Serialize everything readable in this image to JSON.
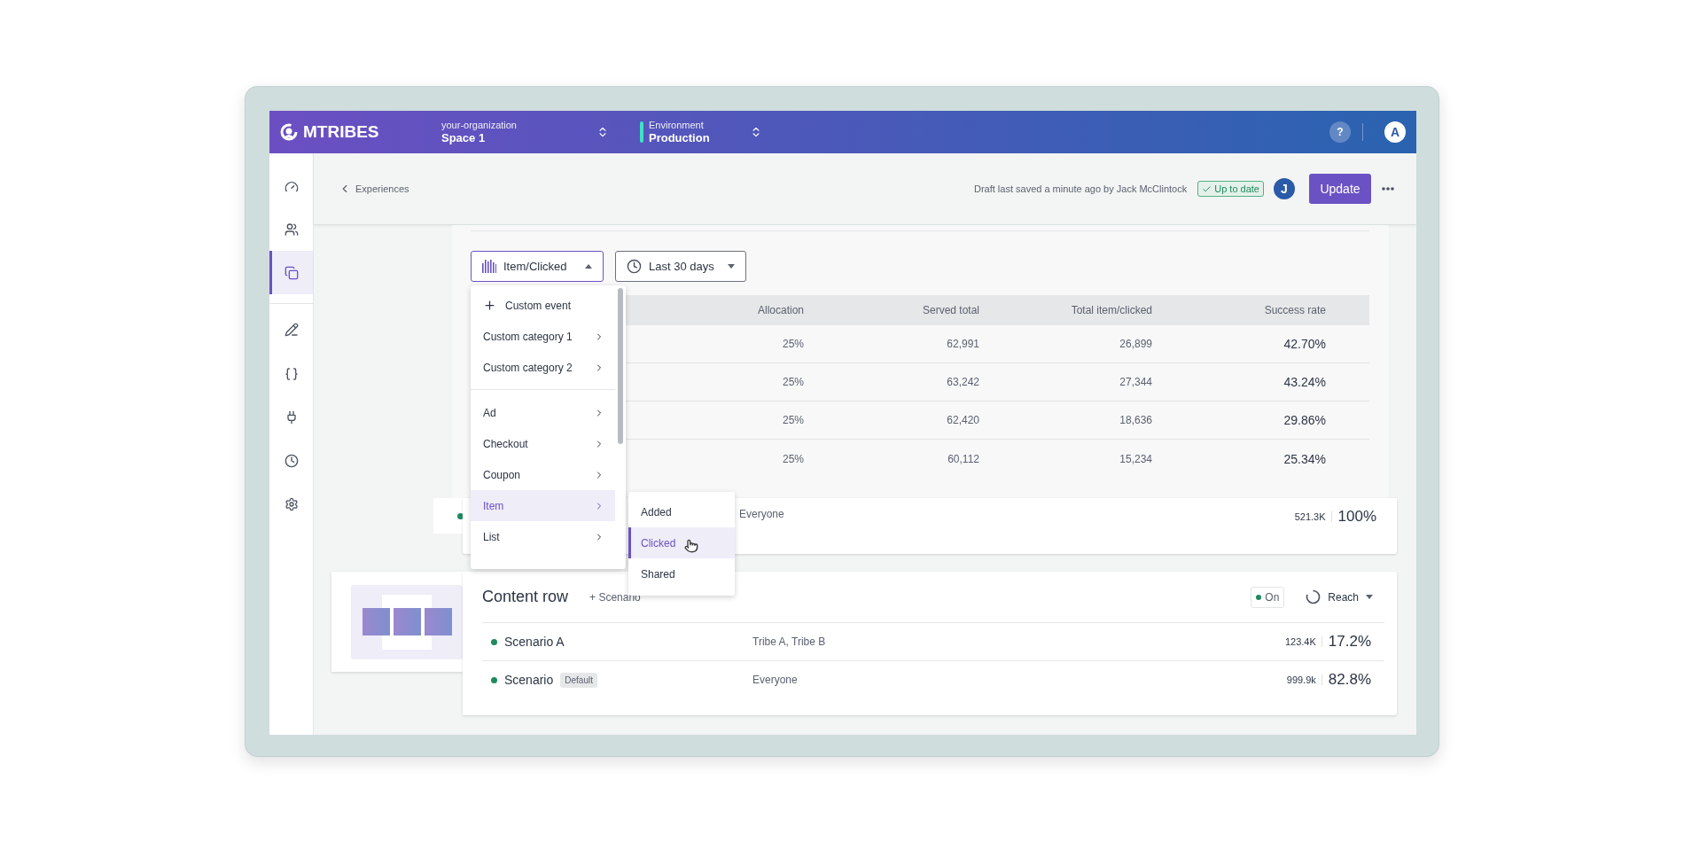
{
  "header": {
    "logo": "MTRIBES",
    "organization": {
      "label": "your-organization",
      "value": "Space 1"
    },
    "environment": {
      "label": "Environment",
      "value": "Production"
    },
    "help": "?",
    "avatar": "A"
  },
  "sidebar": {
    "groups": [
      [
        {
          "selected": false
        },
        {
          "selected": false
        },
        {
          "selected": true
        }
      ],
      [
        {
          "selected": false
        },
        {
          "selected": false
        },
        {
          "selected": false
        },
        {
          "selected": false
        },
        {
          "selected": false
        }
      ]
    ]
  },
  "subheader": {
    "back": "Experiences",
    "draft_note": "Draft last saved a minute ago by Jack McClintock",
    "status_badge": "Up to date",
    "user_avatar": "J",
    "update_button": "Update"
  },
  "experience_card": {
    "metric_dropdown": {
      "label": "Item/Clicked",
      "expanded": true
    },
    "period_dropdown": {
      "label": "Last 30 days"
    },
    "table": {
      "columns": [
        "Allocation",
        "Served total",
        "Total item/clicked",
        "Success rate"
      ],
      "rows": [
        [
          "25%",
          "62,991",
          "26,899",
          "42.70%"
        ],
        [
          "25%",
          "63,242",
          "27,344",
          "43.24%"
        ],
        [
          "25%",
          "62,420",
          "18,636",
          "29.86%"
        ],
        [
          "25%",
          "60,112",
          "15,234",
          "25.34%"
        ]
      ]
    },
    "footer": {
      "audience": "Everyone",
      "served": "521.3K",
      "share": "100%"
    }
  },
  "event_menu": {
    "groups": [
      [
        {
          "kind": "action",
          "label": "Custom event",
          "selected": false
        },
        {
          "kind": "category",
          "label": "Custom category 1",
          "selected": false
        },
        {
          "kind": "category",
          "label": "Custom category 2",
          "selected": false
        }
      ],
      [
        {
          "kind": "category",
          "label": "Ad",
          "selected": false
        },
        {
          "kind": "category",
          "label": "Checkout",
          "selected": false
        },
        {
          "kind": "category",
          "label": "Coupon",
          "selected": false
        },
        {
          "kind": "category",
          "label": "Item",
          "selected": true
        },
        {
          "kind": "category",
          "label": "List",
          "selected": false
        }
      ]
    ],
    "submenu": [
      {
        "label": "Added",
        "selected": false
      },
      {
        "label": "Clicked",
        "selected": true
      },
      {
        "label": "Shared",
        "selected": false
      }
    ]
  },
  "content_row_card": {
    "title": "Content row",
    "add_scenario": "+ Scenario",
    "status": {
      "label": "On",
      "on": true
    },
    "metric": "Reach",
    "scenarios": [
      {
        "name": "Scenario A",
        "audience": "Tribe A, Tribe B",
        "served": "123.4K",
        "share": "17.2%"
      },
      {
        "name": "Scenario",
        "badge": "Default",
        "audience": "Everyone",
        "served": "999.9k",
        "share": "82.8%"
      }
    ]
  }
}
